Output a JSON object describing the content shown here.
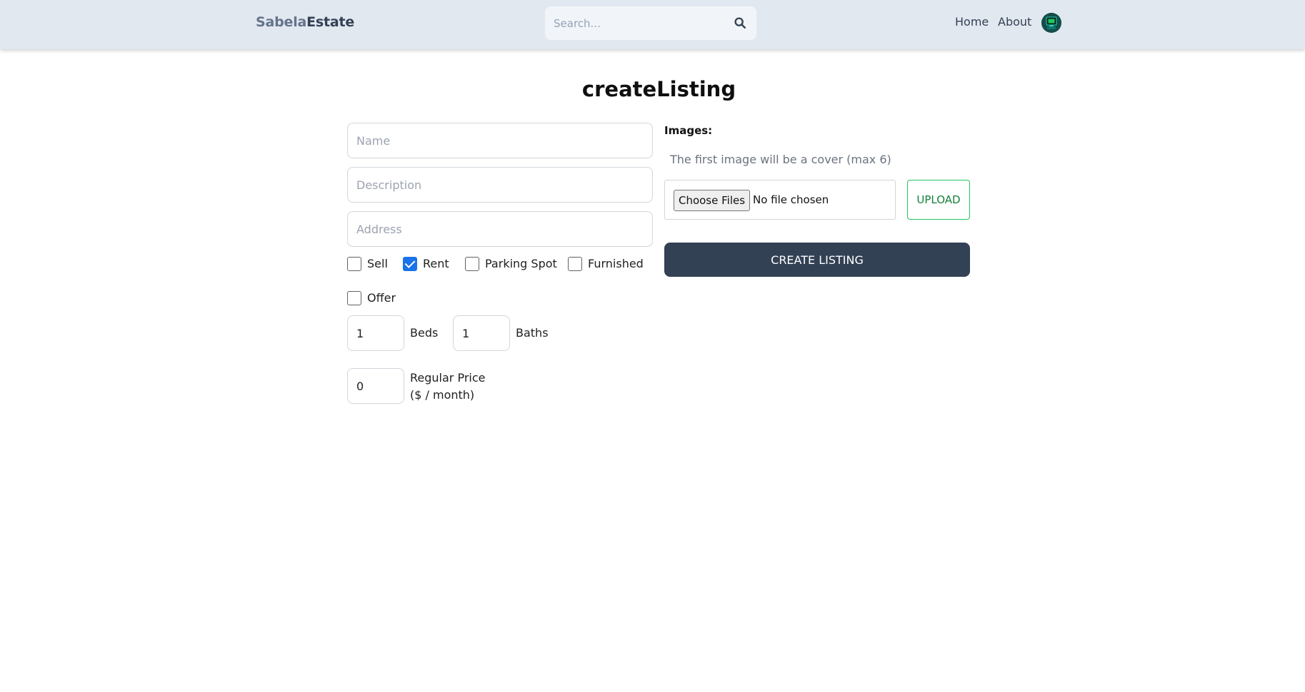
{
  "header": {
    "logo_part1": "Sabela",
    "logo_part2": "Estate",
    "search_placeholder": "Search...",
    "nav": {
      "home": "Home",
      "about": "About"
    }
  },
  "page": {
    "title": "createListing"
  },
  "form": {
    "name_placeholder": "Name",
    "description_placeholder": "Description",
    "address_placeholder": "Address",
    "options": [
      {
        "label": "Sell",
        "checked": false
      },
      {
        "label": "Rent",
        "checked": true
      },
      {
        "label": "Parking Spot",
        "checked": false
      },
      {
        "label": "Furnished",
        "checked": false
      },
      {
        "label": "Offer",
        "checked": false
      }
    ],
    "beds": {
      "value": "1",
      "label": "Beds"
    },
    "baths": {
      "value": "1",
      "label": "Baths"
    },
    "price": {
      "value": "0",
      "label_line1": "Regular Price",
      "label_line2": "($ / month)"
    }
  },
  "images": {
    "label": "Images:",
    "hint": "The first image will be a cover (max 6)",
    "choose_label": "Choose Files",
    "file_status": "No file chosen",
    "upload_label": "UPLOAD"
  },
  "actions": {
    "create_label": "CREATE LISTING"
  },
  "colors": {
    "header_bg": "#e2e8f0",
    "primary": "#334155",
    "upload_accent": "#15803d",
    "checkbox_checked": "#1a73e8"
  }
}
